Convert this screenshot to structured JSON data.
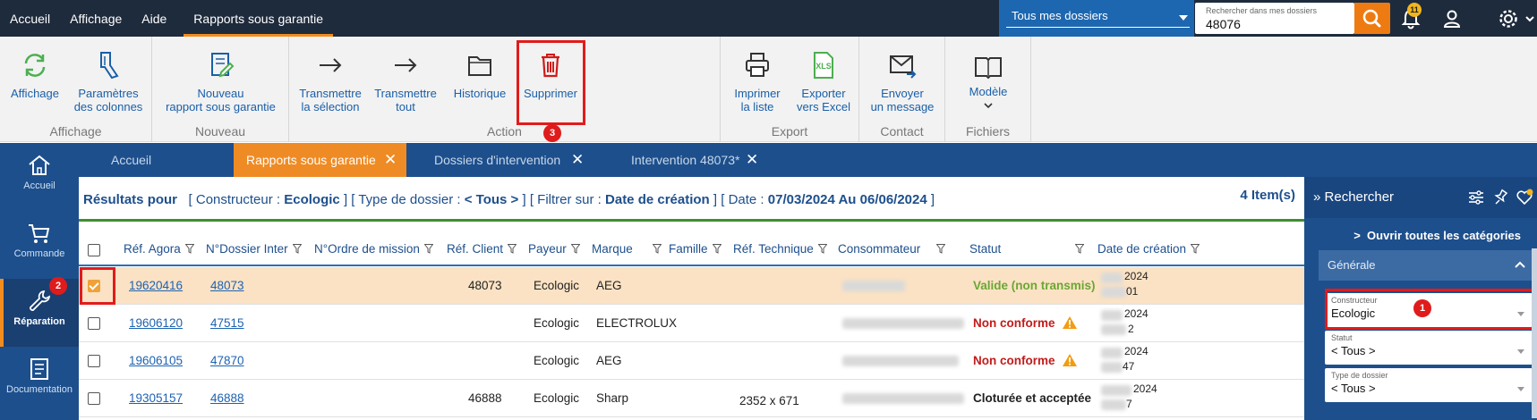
{
  "topbar": {
    "menu": [
      "Accueil",
      "Affichage",
      "Aide",
      "Rapports sous garantie"
    ],
    "active_menu": "Rapports sous garantie",
    "dossiers_select": "Tous mes dossiers",
    "search_placeholder": "Rechercher dans mes dossiers",
    "search_value": "48076",
    "notifications_count": "11"
  },
  "ribbon": {
    "groups": [
      {
        "name": "Affichage",
        "buttons": [
          {
            "label1": "Affichage",
            "label2": ""
          },
          {
            "label1": "Paramètres",
            "label2": "des colonnes"
          }
        ]
      },
      {
        "name": "Nouveau",
        "buttons": [
          {
            "label1": "Nouveau",
            "label2": "rapport sous garantie"
          }
        ]
      },
      {
        "name": "Action",
        "buttons": [
          {
            "label1": "Transmettre",
            "label2": "la sélection"
          },
          {
            "label1": "Transmettre",
            "label2": "tout"
          },
          {
            "label1": "Historique",
            "label2": ""
          },
          {
            "label1": "Supprimer",
            "label2": ""
          }
        ]
      },
      {
        "name": "Export",
        "buttons": [
          {
            "label1": "Imprimer",
            "label2": "la liste"
          },
          {
            "label1": "Exporter",
            "label2": "vers Excel"
          }
        ]
      },
      {
        "name": "Contact",
        "buttons": [
          {
            "label1": "Envoyer",
            "label2": "un message"
          }
        ]
      },
      {
        "name": "Fichiers",
        "buttons": [
          {
            "label1": "Modèle",
            "label2": ""
          }
        ]
      }
    ],
    "xls_text": "XLS"
  },
  "steps": {
    "one": "1",
    "two": "2",
    "three": "3"
  },
  "leftnav": [
    {
      "label": "Accueil",
      "icon": "home-icon"
    },
    {
      "label": "Commande",
      "icon": "cart-icon"
    },
    {
      "label": "Réparation",
      "icon": "wrench-icon"
    },
    {
      "label": "Documentation",
      "icon": "document-icon"
    }
  ],
  "tabs": [
    {
      "label": "Accueil",
      "closable": false
    },
    {
      "label": "Rapports sous garantie",
      "closable": true
    },
    {
      "label": "Dossiers d'intervention",
      "closable": true
    },
    {
      "label": "Intervention 48073*",
      "closable": true
    }
  ],
  "results": {
    "prefix": "Résultats pour",
    "constructeur_label": "[ Constructeur :",
    "constructeur_value": "Ecologic",
    "type_label": "] [ Type de dossier :",
    "type_value": "< Tous >",
    "filtre_label": "] [ Filtrer sur :",
    "filtre_value": "Date de création",
    "date_label": "] [ Date :",
    "date_value": "07/03/2024 Au 06/06/2024",
    "date_end": "]",
    "count": "4 Item(s)"
  },
  "columns": [
    "Réf. Agora",
    "N°Dossier Inter",
    "N°Ordre de mission",
    "Réf. Client",
    "Payeur",
    "Marque",
    "Famille",
    "Réf. Technique",
    "Consommateur",
    "Statut",
    "Date de création"
  ],
  "rows": [
    {
      "ref_agora": "19620416",
      "dossier": "48073",
      "ordre": "",
      "ref_client": "48073",
      "payeur": "Ecologic",
      "marque": "AEG",
      "famille": "",
      "ref_tech": "",
      "statut": "Valide (non transmis)",
      "statut_type": "ok",
      "date_year": "2024",
      "date_suffix": "01",
      "checked": true
    },
    {
      "ref_agora": "19606120",
      "dossier": "47515",
      "ordre": "",
      "ref_client": "",
      "payeur": "Ecologic",
      "marque": "ELECTROLUX",
      "famille": "",
      "ref_tech": "",
      "statut": "Non conforme",
      "statut_type": "nc",
      "date_year": "2024",
      "date_suffix": "2",
      "checked": false
    },
    {
      "ref_agora": "19606105",
      "dossier": "47870",
      "ordre": "",
      "ref_client": "",
      "payeur": "Ecologic",
      "marque": "AEG",
      "famille": "",
      "ref_tech": "",
      "statut": "Non conforme",
      "statut_type": "nc",
      "date_year": "2024",
      "date_suffix": "47",
      "checked": false
    },
    {
      "ref_agora": "19305157",
      "dossier": "46888",
      "ordre": "",
      "ref_client": "46888",
      "payeur": "Ecologic",
      "marque": "Sharp",
      "famille": "",
      "ref_tech": "2352 x 671",
      "statut": "Cloturée et acceptée",
      "statut_type": "closed",
      "date_year": "2024",
      "date_suffix": "7",
      "checked": false
    }
  ],
  "rightpanel": {
    "title": "Rechercher",
    "open_all": "Ouvrir toutes les catégories",
    "section": "Générale",
    "fields": [
      {
        "label": "Constructeur",
        "value": "Ecologic"
      },
      {
        "label": "Statut",
        "value": "< Tous >"
      },
      {
        "label": "Type de dossier",
        "value": "< Tous >"
      }
    ]
  },
  "colors": {
    "accent": "#f28c1e",
    "nav": "#1d4f8c",
    "topbar": "#1e2b3c",
    "highlight": "#e21b1b",
    "selected_row": "#fbe2c4"
  }
}
